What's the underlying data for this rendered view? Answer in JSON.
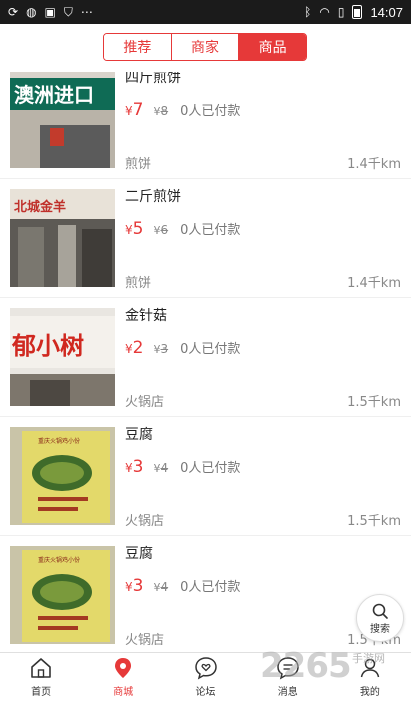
{
  "status_bar": {
    "time": "14:07"
  },
  "header": {
    "tabs": [
      {
        "label": "推荐",
        "active": false
      },
      {
        "label": "商家",
        "active": false
      },
      {
        "label": "商品",
        "active": true
      }
    ]
  },
  "products": [
    {
      "title": "四斤煎饼",
      "currency": "¥",
      "price": "7",
      "orig_currency": "¥",
      "orig_price": "8",
      "paid": "0人已付款",
      "category": "煎饼",
      "distance": "1.4千km",
      "image_icon": "storefront-photo",
      "sign_text": "澳洲进口"
    },
    {
      "title": "二斤煎饼",
      "currency": "¥",
      "price": "5",
      "orig_currency": "¥",
      "orig_price": "6",
      "paid": "0人已付款",
      "category": "煎饼",
      "distance": "1.4千km",
      "image_icon": "storefront-photo",
      "sign_text": "北城金羊"
    },
    {
      "title": "金针菇",
      "currency": "¥",
      "price": "2",
      "orig_currency": "¥",
      "orig_price": "3",
      "paid": "0人已付款",
      "category": "火锅店",
      "distance": "1.5千km",
      "image_icon": "storefront-photo",
      "sign_text": "郁小树"
    },
    {
      "title": "豆腐",
      "currency": "¥",
      "price": "3",
      "orig_currency": "¥",
      "orig_price": "4",
      "paid": "0人已付款",
      "category": "火锅店",
      "distance": "1.5千km",
      "image_icon": "menu-photo",
      "sign_text": "重庆火锅鸡小份"
    },
    {
      "title": "豆腐",
      "currency": "¥",
      "price": "3",
      "orig_currency": "¥",
      "orig_price": "4",
      "paid": "0人已付款",
      "category": "火锅店",
      "distance": "1.5千km",
      "image_icon": "menu-photo",
      "sign_text": "重庆火锅鸡小份"
    }
  ],
  "fab": {
    "label": "搜索",
    "icon": "search-icon"
  },
  "tabbar": {
    "items": [
      {
        "label": "首页",
        "icon": "home-icon",
        "active": false
      },
      {
        "label": "商城",
        "icon": "location-pin-icon",
        "active": true
      },
      {
        "label": "论坛",
        "icon": "chat-heart-icon",
        "active": false
      },
      {
        "label": "消息",
        "icon": "message-icon",
        "active": false
      },
      {
        "label": "我的",
        "icon": "user-icon",
        "active": false
      }
    ]
  },
  "watermark": {
    "text": "2265",
    "suffix": ".com",
    "sub": "手游网"
  },
  "colors": {
    "accent": "#e63939",
    "status_bar": "#1b1b1b",
    "muted_text": "#888888"
  }
}
